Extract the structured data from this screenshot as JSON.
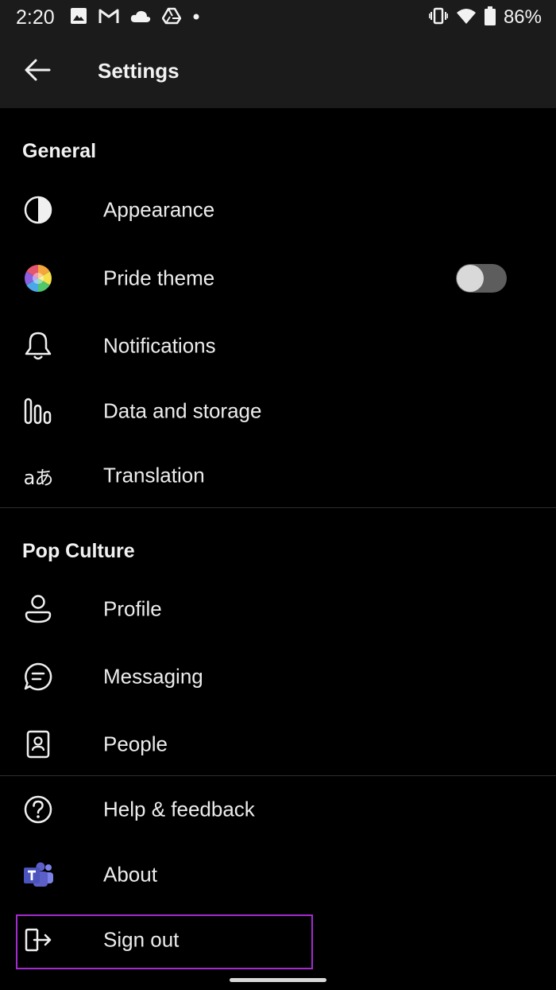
{
  "status_bar": {
    "time": "2:20",
    "battery": "86%",
    "left_icons": [
      "image-icon",
      "gmail-icon",
      "cloud-icon",
      "drive-icon",
      "dot-icon"
    ],
    "right_icons": [
      "vibrate-icon",
      "wifi-icon",
      "battery-icon"
    ]
  },
  "app_bar": {
    "title": "Settings",
    "back_icon": "arrow-left-icon"
  },
  "sections": {
    "general": {
      "header": "General",
      "items": [
        {
          "label": "Appearance",
          "icon": "half-circle-icon"
        },
        {
          "label": "Pride theme",
          "icon": "rainbow-circle-icon",
          "toggle_on": false
        },
        {
          "label": "Notifications",
          "icon": "bell-icon"
        },
        {
          "label": "Data and storage",
          "icon": "bar-chart-icon"
        },
        {
          "label": "Translation",
          "icon": "translation-icon",
          "glyph": "aあ"
        }
      ]
    },
    "pop_culture": {
      "header": "Pop Culture",
      "items": [
        {
          "label": "Profile",
          "icon": "person-icon"
        },
        {
          "label": "Messaging",
          "icon": "chat-icon"
        },
        {
          "label": "People",
          "icon": "contacts-icon"
        }
      ]
    },
    "more": {
      "items": [
        {
          "label": "Help & feedback",
          "icon": "help-circle-icon"
        },
        {
          "label": "About",
          "icon": "teams-logo-icon"
        },
        {
          "label": "Sign out",
          "icon": "sign-out-icon"
        }
      ]
    }
  },
  "colors": {
    "background": "#000000",
    "bar_background": "#1b1b1b",
    "highlight": "#a52bd0",
    "teams_brand": "#5b5fc7"
  }
}
